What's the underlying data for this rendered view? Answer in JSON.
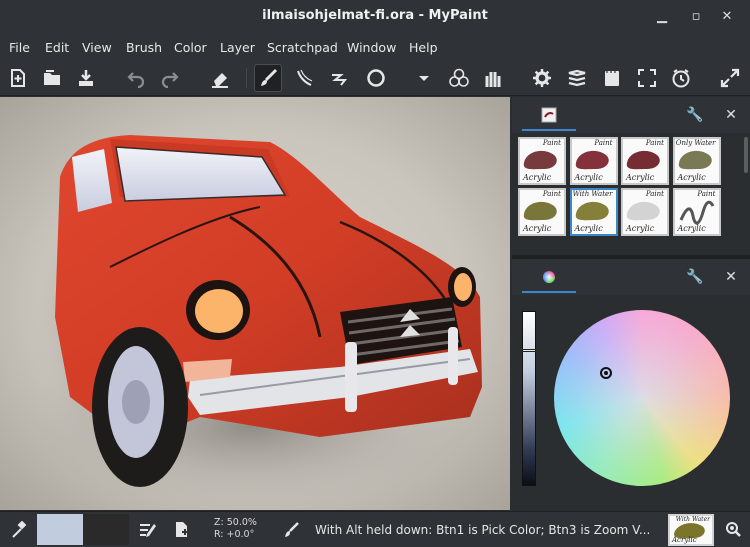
{
  "window": {
    "title": "ilmaisohjelmat-fi.ora - MyPaint"
  },
  "menubar": {
    "items": [
      "File",
      "Edit",
      "View",
      "Brush",
      "Color",
      "Layer",
      "Scratchpad",
      "Window",
      "Help"
    ]
  },
  "toolbar": {
    "icons": [
      "new-document-icon",
      "open-document-icon",
      "save-document-icon",
      "undo-icon",
      "redo-icon",
      "eraser-icon",
      "freehand-brush-icon",
      "ink-pen-icon",
      "connected-lines-icon",
      "ellipse-icon",
      "dropdown-icon",
      "color-mixer-icon",
      "brush-groups-icon",
      "settings-icon",
      "layers-icon",
      "scratchpad-icon",
      "fullscreen-icon",
      "history-icon",
      "expand-icon"
    ],
    "active_tool": "freehand-brush-icon"
  },
  "brush_panel": {
    "brushes": [
      {
        "label": "Acrylic",
        "tag": "Paint",
        "color": "#6b2a2e"
      },
      {
        "label": "Acrylic",
        "tag": "Paint",
        "color": "#7a1f2a"
      },
      {
        "label": "Acrylic",
        "tag": "Paint",
        "color": "#6a1a22"
      },
      {
        "label": "Acrylic",
        "tag": "Only Water",
        "color": "#6e6e46"
      },
      {
        "label": "Acrylic",
        "tag": "Paint",
        "color": "#6f6a28"
      },
      {
        "label": "Acrylic",
        "tag": "With Water",
        "color": "#7a7528"
      },
      {
        "label": "Acrylic",
        "tag": "Paint",
        "color": "#cfcfcf"
      },
      {
        "label": "Acrylic",
        "tag": "Paint",
        "color": "#555555"
      }
    ]
  },
  "color_panel": {
    "value_slider": 0.22
  },
  "statusbar": {
    "zoom_line": "Z: 50.0%",
    "rotation_line": "R: +0.0°",
    "message": "With Alt held down:  Btn1 is Pick Color;  Btn3 is Zoom V...",
    "colors": {
      "current": "#c1ccdf",
      "previous": "#2a2a2a"
    },
    "brush_preview": {
      "label": "Acrylic",
      "tag": "With Water"
    }
  }
}
